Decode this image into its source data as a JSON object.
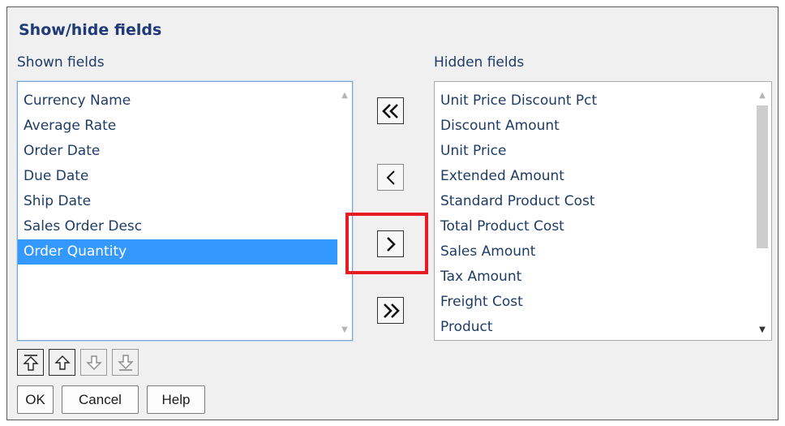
{
  "dialog": {
    "title": "Show/hide fields"
  },
  "shown": {
    "label": "Shown fields",
    "items": [
      "Currency Name",
      "Average Rate",
      "Order Date",
      "Due Date",
      "Ship Date",
      "Sales Order Desc",
      "Order Quantity"
    ],
    "selected": "Order Quantity"
  },
  "hidden": {
    "label": "Hidden fields",
    "items": [
      "Unit Price Discount Pct",
      "Discount Amount",
      "Unit Price",
      "Extended Amount",
      "Standard Product Cost",
      "Total Product Cost",
      "Sales Amount",
      "Tax Amount",
      "Freight Cost",
      "Product"
    ]
  },
  "move_buttons": {
    "show_all_icon": "double-chevron-left-icon",
    "show_selected_icon": "chevron-left-icon",
    "hide_selected_icon": "chevron-right-icon",
    "hide_all_icon": "double-chevron-right-icon",
    "highlighted": "hide_selected"
  },
  "order_buttons": {
    "move_top_icon": "arrow-to-top-icon",
    "move_up_icon": "arrow-up-icon",
    "move_down_icon": "arrow-down-icon",
    "move_bottom_icon": "arrow-to-bottom-icon"
  },
  "actions": {
    "ok": "OK",
    "cancel": "Cancel",
    "help": "Help"
  },
  "colors": {
    "title": "#1e3a78",
    "text": "#1f3c66",
    "selection": "#3399ff",
    "highlight_box": "#e51c23"
  }
}
